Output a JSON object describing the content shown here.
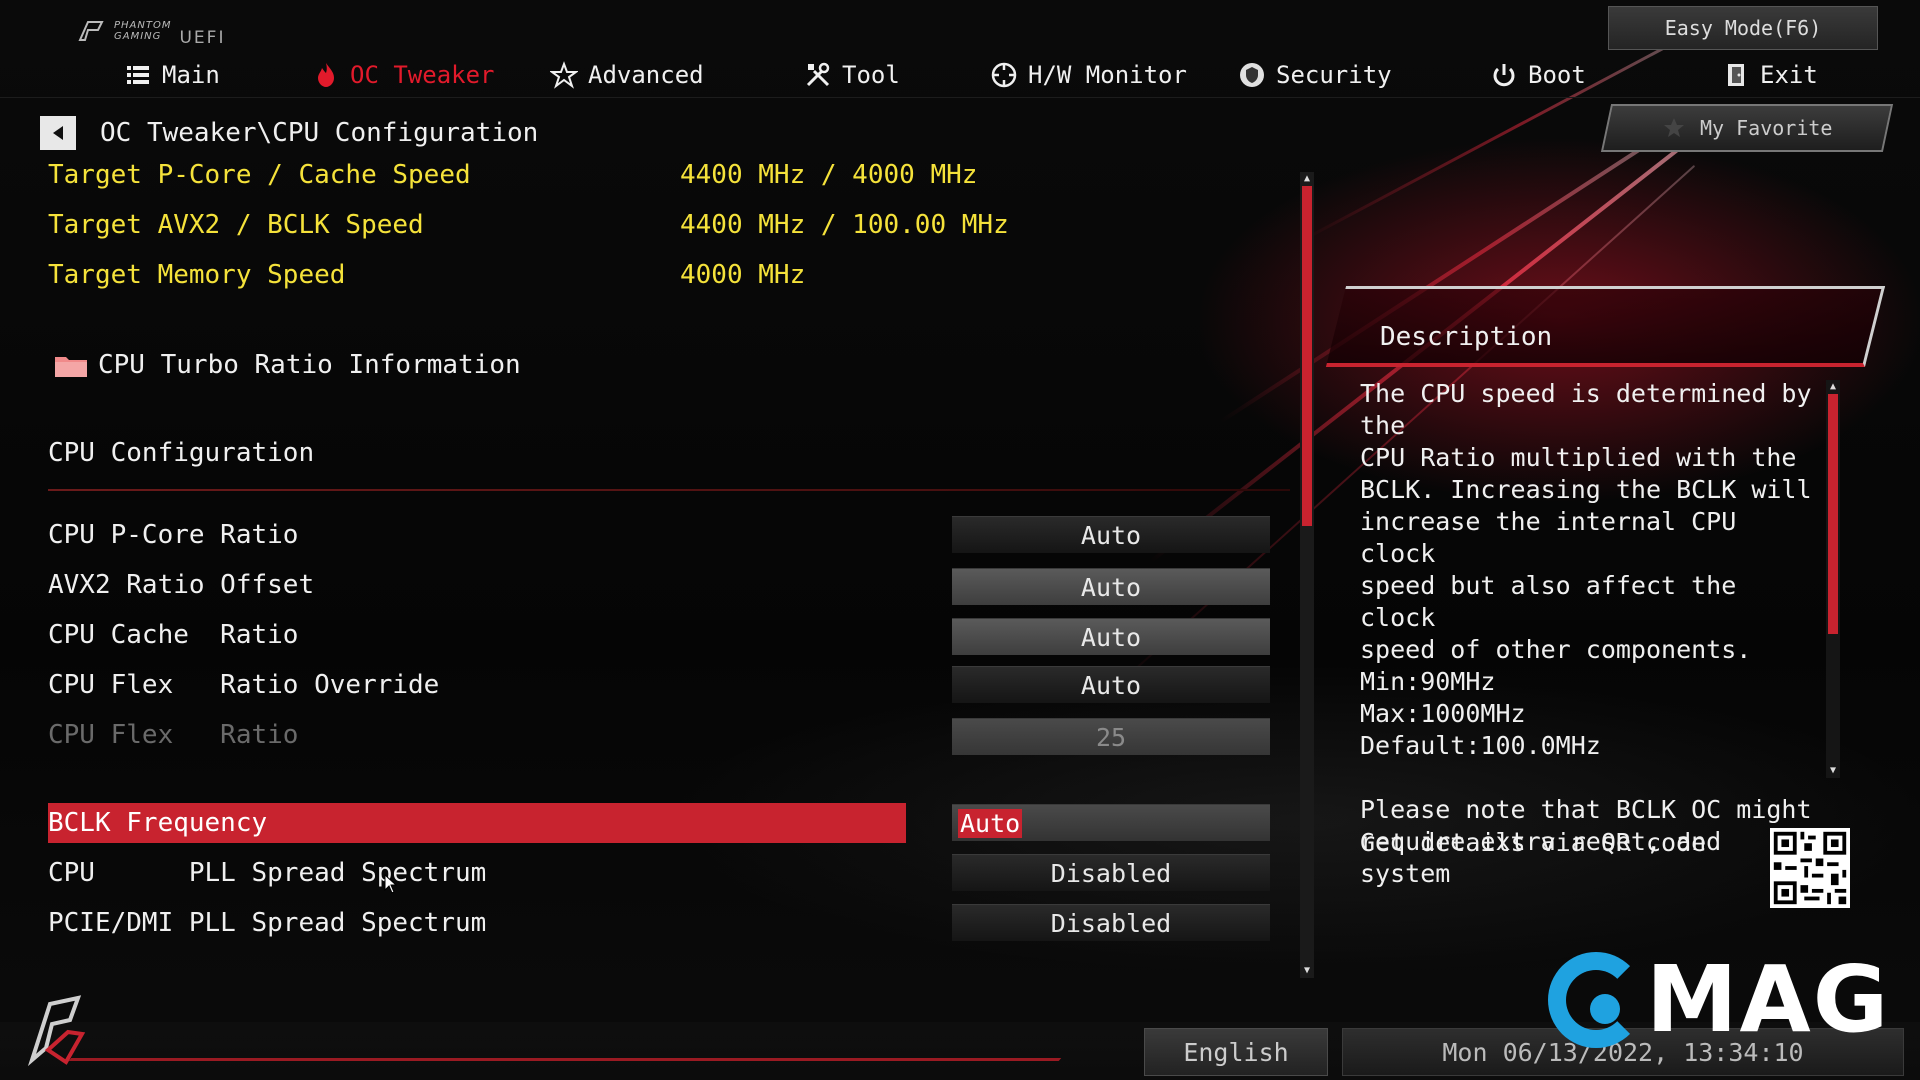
{
  "brand": {
    "line1": "PHANTOM",
    "line2": "GAMING",
    "uefi": "UEFI"
  },
  "easy_mode_label": "Easy Mode(F6)",
  "nav": {
    "tabs": [
      {
        "label": "Main",
        "icon": "list-icon"
      },
      {
        "label": "OC Tweaker",
        "icon": "flame-icon",
        "active": true
      },
      {
        "label": "Advanced",
        "icon": "star-icon"
      },
      {
        "label": "Tool",
        "icon": "tools-icon"
      },
      {
        "label": "H/W Monitor",
        "icon": "monitor-icon"
      },
      {
        "label": "Security",
        "icon": "shield-icon"
      },
      {
        "label": "Boot",
        "icon": "power-icon"
      },
      {
        "label": "Exit",
        "icon": "exit-icon"
      }
    ]
  },
  "breadcrumb": "OC Tweaker\\CPU Configuration",
  "my_favorite_label": "My Favorite",
  "targets": [
    {
      "label": "Target P-Core / Cache Speed",
      "value": "4400 MHz / 4000 MHz"
    },
    {
      "label": "Target AVX2 / BCLK Speed",
      "value": "4400 MHz / 100.00 MHz"
    },
    {
      "label": "Target Memory Speed",
      "value": "4000 MHz"
    }
  ],
  "turbo_folder_label": "CPU Turbo Ratio Information",
  "section_title": "CPU Configuration",
  "options": [
    {
      "label": "CPU P-Core Ratio",
      "value": "Auto"
    },
    {
      "label": "AVX2 Ratio Offset",
      "value": "Auto"
    },
    {
      "label": "CPU Cache  Ratio",
      "value": "Auto"
    },
    {
      "label": "CPU Flex   Ratio Override",
      "value": "Auto"
    },
    {
      "label": "CPU Flex   Ratio",
      "value": "25",
      "disabled": true
    },
    {
      "label": "BCLK Frequency",
      "value": "Auto",
      "selected": true
    },
    {
      "label": "CPU      PLL Spread Spectrum",
      "value": "Disabled"
    },
    {
      "label": "PCIE/DMI PLL Spread Spectrum",
      "value": "Disabled"
    }
  ],
  "description": {
    "title": "Description",
    "text": "The CPU speed is determined by the\nCPU Ratio multiplied with the\nBCLK. Increasing the BCLK will\nincrease the internal CPU clock\nspeed but also affect the clock\nspeed of other components.\nMin:90MHz\nMax:1000MHz\nDefault:100.0MHz\n\nPlease note that BCLK OC might\nrequire extra reset, and system"
  },
  "qr_label": "Get details via QR code",
  "footer": {
    "language": "English",
    "datetime": "Mon 06/13/2022, 13:34:10"
  },
  "watermark": "MAG",
  "colors": {
    "accent": "#c8232f",
    "target_text": "#f5e23a",
    "active_tab": "#e21a2b"
  }
}
